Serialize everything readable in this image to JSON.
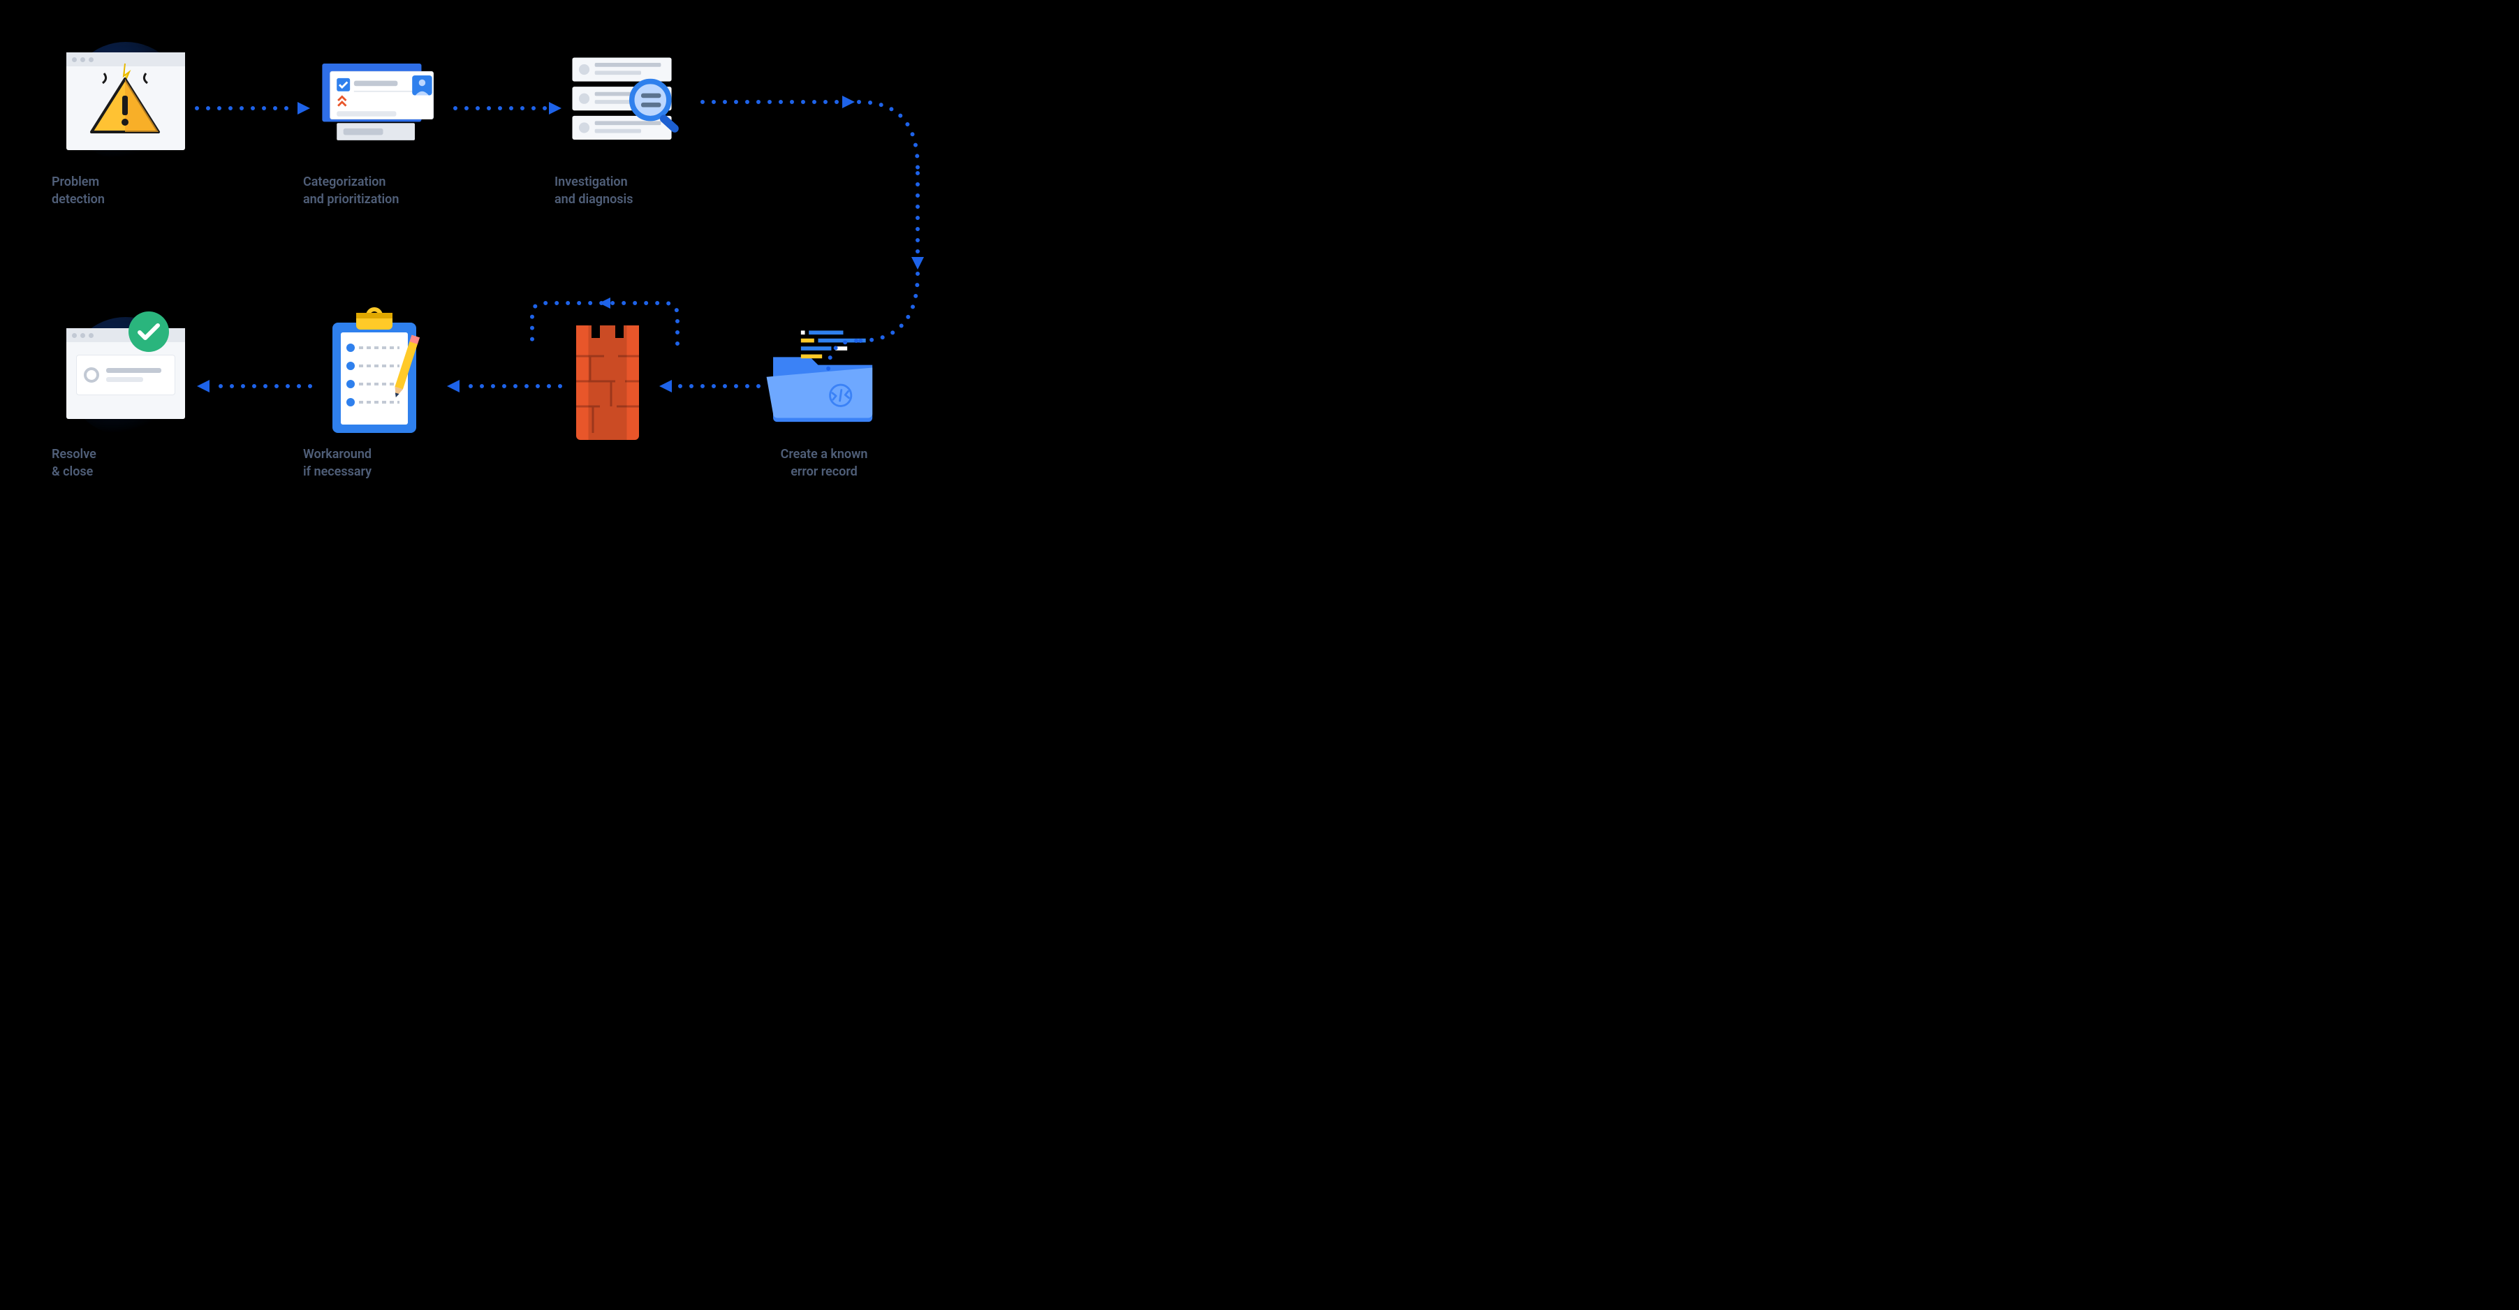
{
  "steps": {
    "detection": {
      "line1": "Problem",
      "line2": "detection"
    },
    "categorization": {
      "line1": "Categorization",
      "line2": "and prioritization"
    },
    "investigation": {
      "line1": "Investigation",
      "line2": "and diagnosis"
    },
    "error_record": {
      "line1": "Create a known",
      "line2": "error record"
    },
    "workaround": {
      "line1": "Workaround",
      "line2": "if necessary"
    },
    "resolve": {
      "line1": "Resolve",
      "line2": "& close"
    }
  }
}
